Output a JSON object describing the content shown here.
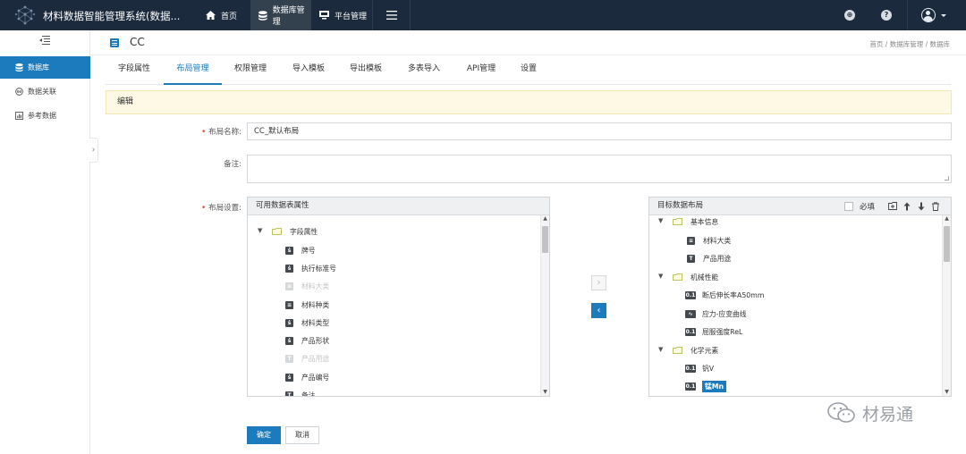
{
  "app": {
    "title": "材料数据智能管理系统(数据..."
  },
  "topnav": [
    {
      "label": "首页"
    },
    {
      "label": "数据库管理"
    },
    {
      "label": "平台管理"
    }
  ],
  "sidebar": {
    "items": [
      {
        "label": "数据库"
      },
      {
        "label": "数据关联"
      },
      {
        "label": "参考数据"
      }
    ],
    "expand_glyph": "›"
  },
  "header": {
    "title": "CC",
    "breadcrumb": "首页 / 数据库管理 / 数据库"
  },
  "tabs": [
    "字段属性",
    "布局管理",
    "权限管理",
    "导入模板",
    "导出模板",
    "多表导入",
    "API管理",
    "设置"
  ],
  "notice": "编辑",
  "form": {
    "layout_name_label": "布局名称:",
    "layout_name_value": "CC_默认布局",
    "remark_label": "备注:",
    "layout_setting_label": "布局设置:"
  },
  "available": {
    "title": "可用数据表属性",
    "group": "字段属性",
    "items": [
      {
        "label": "牌号",
        "icon": "ṡ",
        "state": "enabled"
      },
      {
        "label": "执行标准号",
        "icon": "ṡ",
        "state": "enabled"
      },
      {
        "label": "材料大类",
        "icon": "≡",
        "state": "disabled"
      },
      {
        "label": "材料种类",
        "icon": "≡",
        "state": "enabled"
      },
      {
        "label": "材料类型",
        "icon": "ṡ",
        "state": "enabled"
      },
      {
        "label": "产品形状",
        "icon": "ṡ",
        "state": "enabled"
      },
      {
        "label": "产品用途",
        "icon": "T",
        "state": "disabled"
      },
      {
        "label": "产品编号",
        "icon": "ṡ",
        "state": "enabled"
      },
      {
        "label": "备注",
        "icon": "T",
        "state": "enabled"
      }
    ]
  },
  "target": {
    "title": "目标数据布局",
    "required_label": "必填",
    "tools": [
      "▣",
      "↑",
      "↓",
      "🗑"
    ],
    "groups": [
      {
        "label": "基本信息",
        "items": [
          {
            "label": "材料大类",
            "icon": "≡"
          },
          {
            "label": "产品用途",
            "icon": "T"
          }
        ]
      },
      {
        "label": "机械性能",
        "items": [
          {
            "label": "断后伸长率A50mm",
            "icon": "0.1"
          },
          {
            "label": "应力-应变曲线",
            "icon": "∿"
          },
          {
            "label": "屈服强度ReL",
            "icon": "0.1"
          }
        ]
      },
      {
        "label": "化学元素",
        "items": [
          {
            "label": "钒V",
            "icon": "0.1"
          },
          {
            "label": "锰Mn",
            "icon": "0.1",
            "selected": true
          }
        ]
      }
    ]
  },
  "buttons": {
    "ok": "确定",
    "cancel": "取消",
    "move_right": "›",
    "move_left": "‹"
  },
  "watermark": "材易通",
  "colors": {
    "primary": "#1c7bbd",
    "topbar": "#1b2a3d",
    "notice_bg": "#fdf9e4",
    "required": "#e0452a"
  }
}
